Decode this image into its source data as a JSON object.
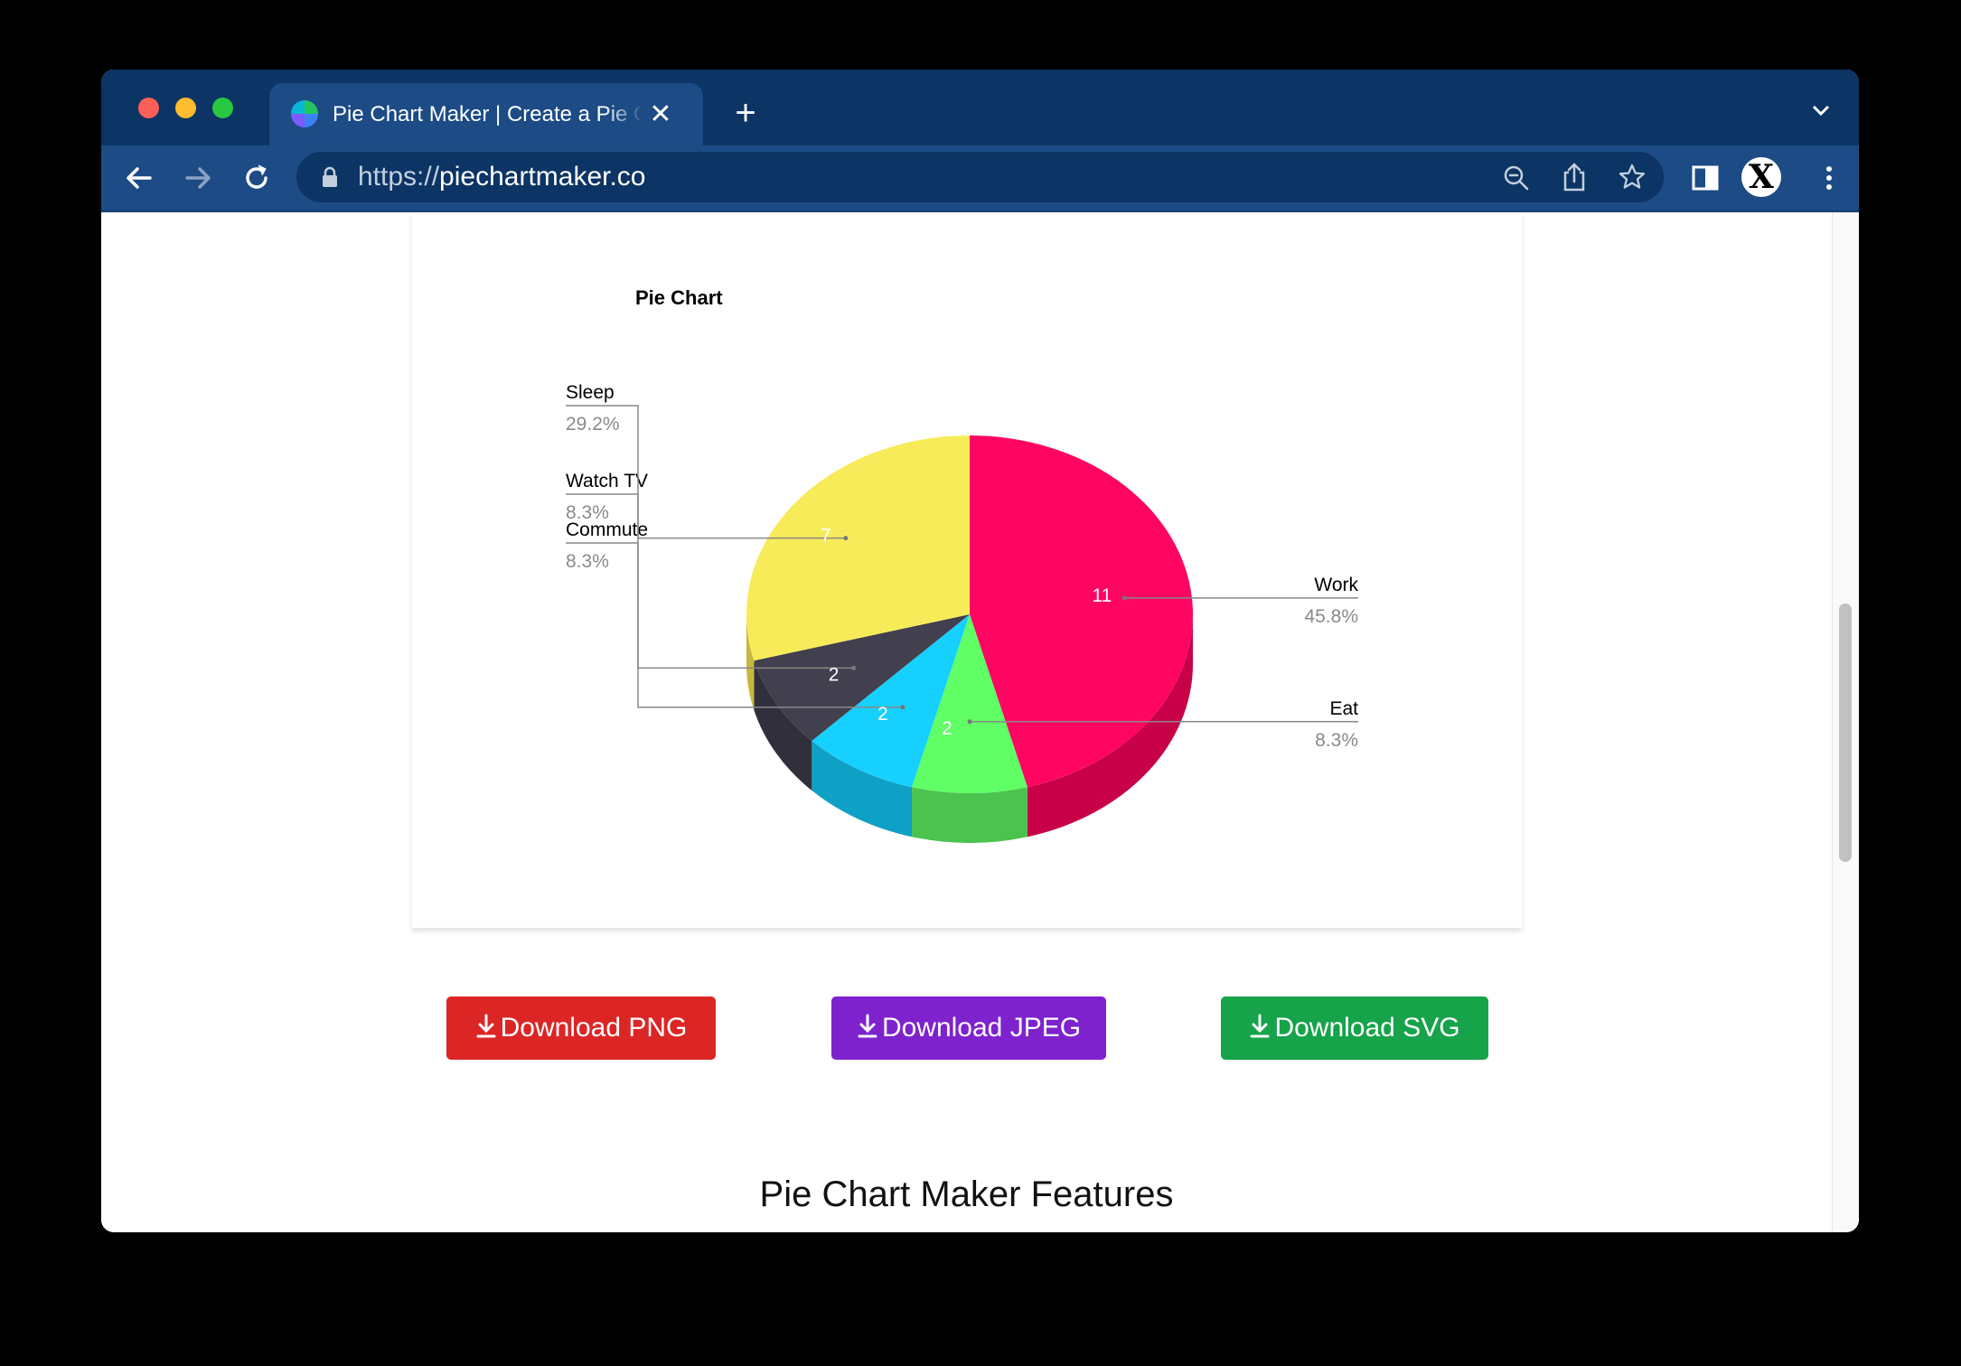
{
  "browser": {
    "tab_title": "Pie Chart Maker | Create a Pie Chart",
    "url_scheme": "https://",
    "url_host": "piechartmaker.co",
    "profile_initial": "X"
  },
  "buttons": {
    "png": "Download PNG",
    "jpeg": "Download JPEG",
    "svg": "Download SVG"
  },
  "features_title": "Pie Chart Maker Features",
  "chart_data": {
    "type": "pie",
    "style": "3d",
    "title": "Pie Chart",
    "slices": [
      {
        "label": "Work",
        "value": 11,
        "percent": "45.8%",
        "color": "#fe0561",
        "side_color": "#c80048"
      },
      {
        "label": "Eat",
        "value": 2,
        "percent": "8.3%",
        "color": "#5fff66",
        "side_color": "#4cc24f"
      },
      {
        "label": "Commute",
        "value": 2,
        "percent": "8.3%",
        "color": "#16d0ff",
        "side_color": "#0fa0c6"
      },
      {
        "label": "Watch TV",
        "value": 2,
        "percent": "8.3%",
        "color": "#423f4e",
        "side_color": "#322f3d"
      },
      {
        "label": "Sleep",
        "value": 7,
        "percent": "29.2%",
        "color": "#f8eb5a",
        "side_color": "#c7b83c"
      }
    ]
  }
}
